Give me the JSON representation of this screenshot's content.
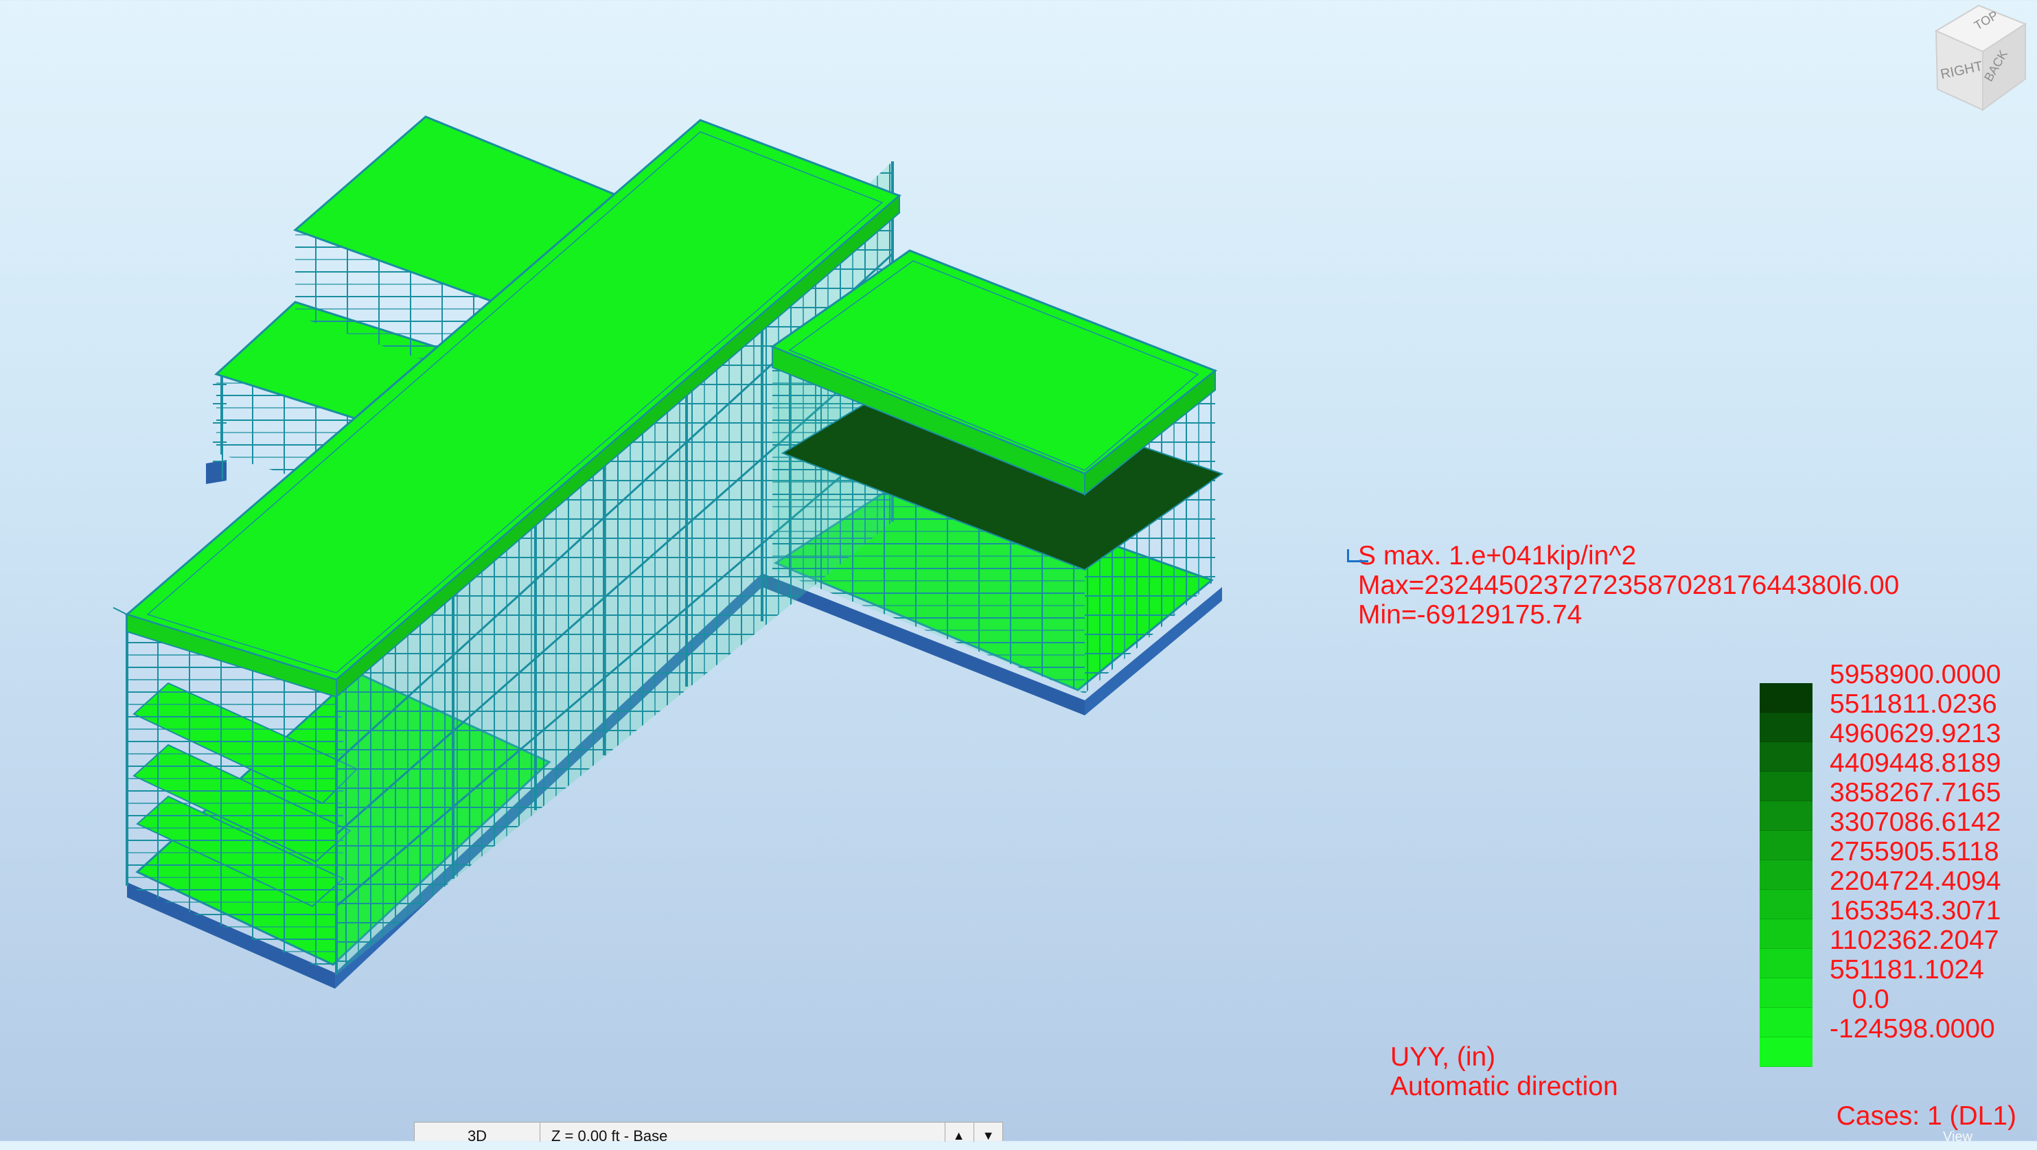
{
  "result_header": {
    "title": "S max. 1.e+041kip/in^2",
    "max": "Max=2324450237272358702817644380l6.00",
    "min": "Min=-69129175.74"
  },
  "legend": {
    "labels": [
      "5958900.0000",
      "5511811.0236",
      "4960629.9213",
      "4409448.8189",
      "3858267.7165",
      "3307086.6142",
      "2755905.5118",
      "2204724.4094",
      "1653543.3071",
      "1102362.2047",
      "551181.1024",
      "   0.0",
      "-124598.0000"
    ],
    "colors": [
      "#043c04",
      "#065206",
      "#08680a",
      "#0a7c0c",
      "#0c8f0e",
      "#0d9f10",
      "#0eae12",
      "#0fbd14",
      "#10ca16",
      "#11d718",
      "#12e31a",
      "#13ee1c",
      "#14f81e"
    ]
  },
  "component": {
    "quantity": "UYY, (in)",
    "direction": "Automatic direction"
  },
  "cases": "Cases: 1 (DL1)",
  "view_bar": {
    "mode": "3D",
    "level": "Z = 0.00 ft - Base"
  },
  "viewcube": {
    "faces": [
      "TOP",
      "RIGHT",
      "BACK"
    ]
  },
  "view_tab": "View",
  "colors": {
    "slab": "#15f11c",
    "edge": "#1a8fa0",
    "foundation": "#2a5fa8",
    "highlight_slab": "#0e4f12",
    "text": "#ff1414"
  }
}
